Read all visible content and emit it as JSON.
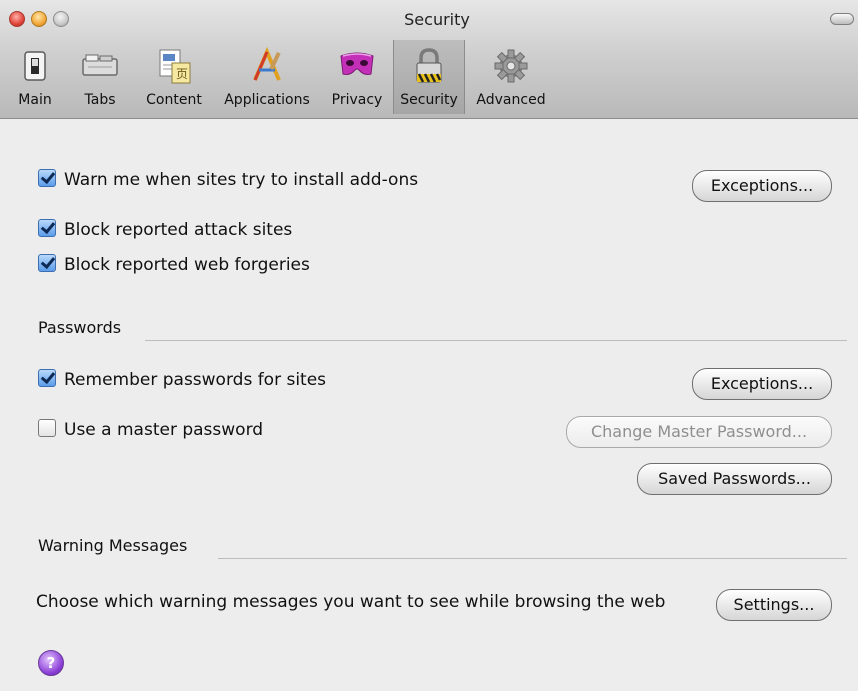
{
  "window": {
    "title": "Security"
  },
  "toolbar": {
    "items": [
      {
        "label": "Main",
        "icon": "switch-icon"
      },
      {
        "label": "Tabs",
        "icon": "tabs-icon"
      },
      {
        "label": "Content",
        "icon": "content-icon"
      },
      {
        "label": "Applications",
        "icon": "applications-icon"
      },
      {
        "label": "Privacy",
        "icon": "mask-icon"
      },
      {
        "label": "Security",
        "icon": "padlock-icon",
        "selected": true
      },
      {
        "label": "Advanced",
        "icon": "gear-icon"
      }
    ]
  },
  "main": {
    "warn_addons": {
      "label": "Warn me when sites try to install add-ons",
      "checked": true
    },
    "exceptions_label": "Exceptions...",
    "block_attack": {
      "label": "Block reported attack sites",
      "checked": true
    },
    "block_forgeries": {
      "label": "Block reported web forgeries",
      "checked": true
    }
  },
  "passwords": {
    "heading": "Passwords",
    "remember": {
      "label": "Remember passwords for sites",
      "checked": true
    },
    "exceptions_label": "Exceptions...",
    "master": {
      "label": "Use a master password",
      "checked": false
    },
    "change_master_label": "Change Master Password...",
    "saved_label": "Saved Passwords..."
  },
  "warnings": {
    "heading": "Warning Messages",
    "text": "Choose which warning messages you want to see while browsing the web",
    "settings_label": "Settings..."
  },
  "help": {
    "label": "?"
  },
  "colors": {
    "accent_check": "#5c9cea",
    "help_purple": "#8b3fd6"
  }
}
